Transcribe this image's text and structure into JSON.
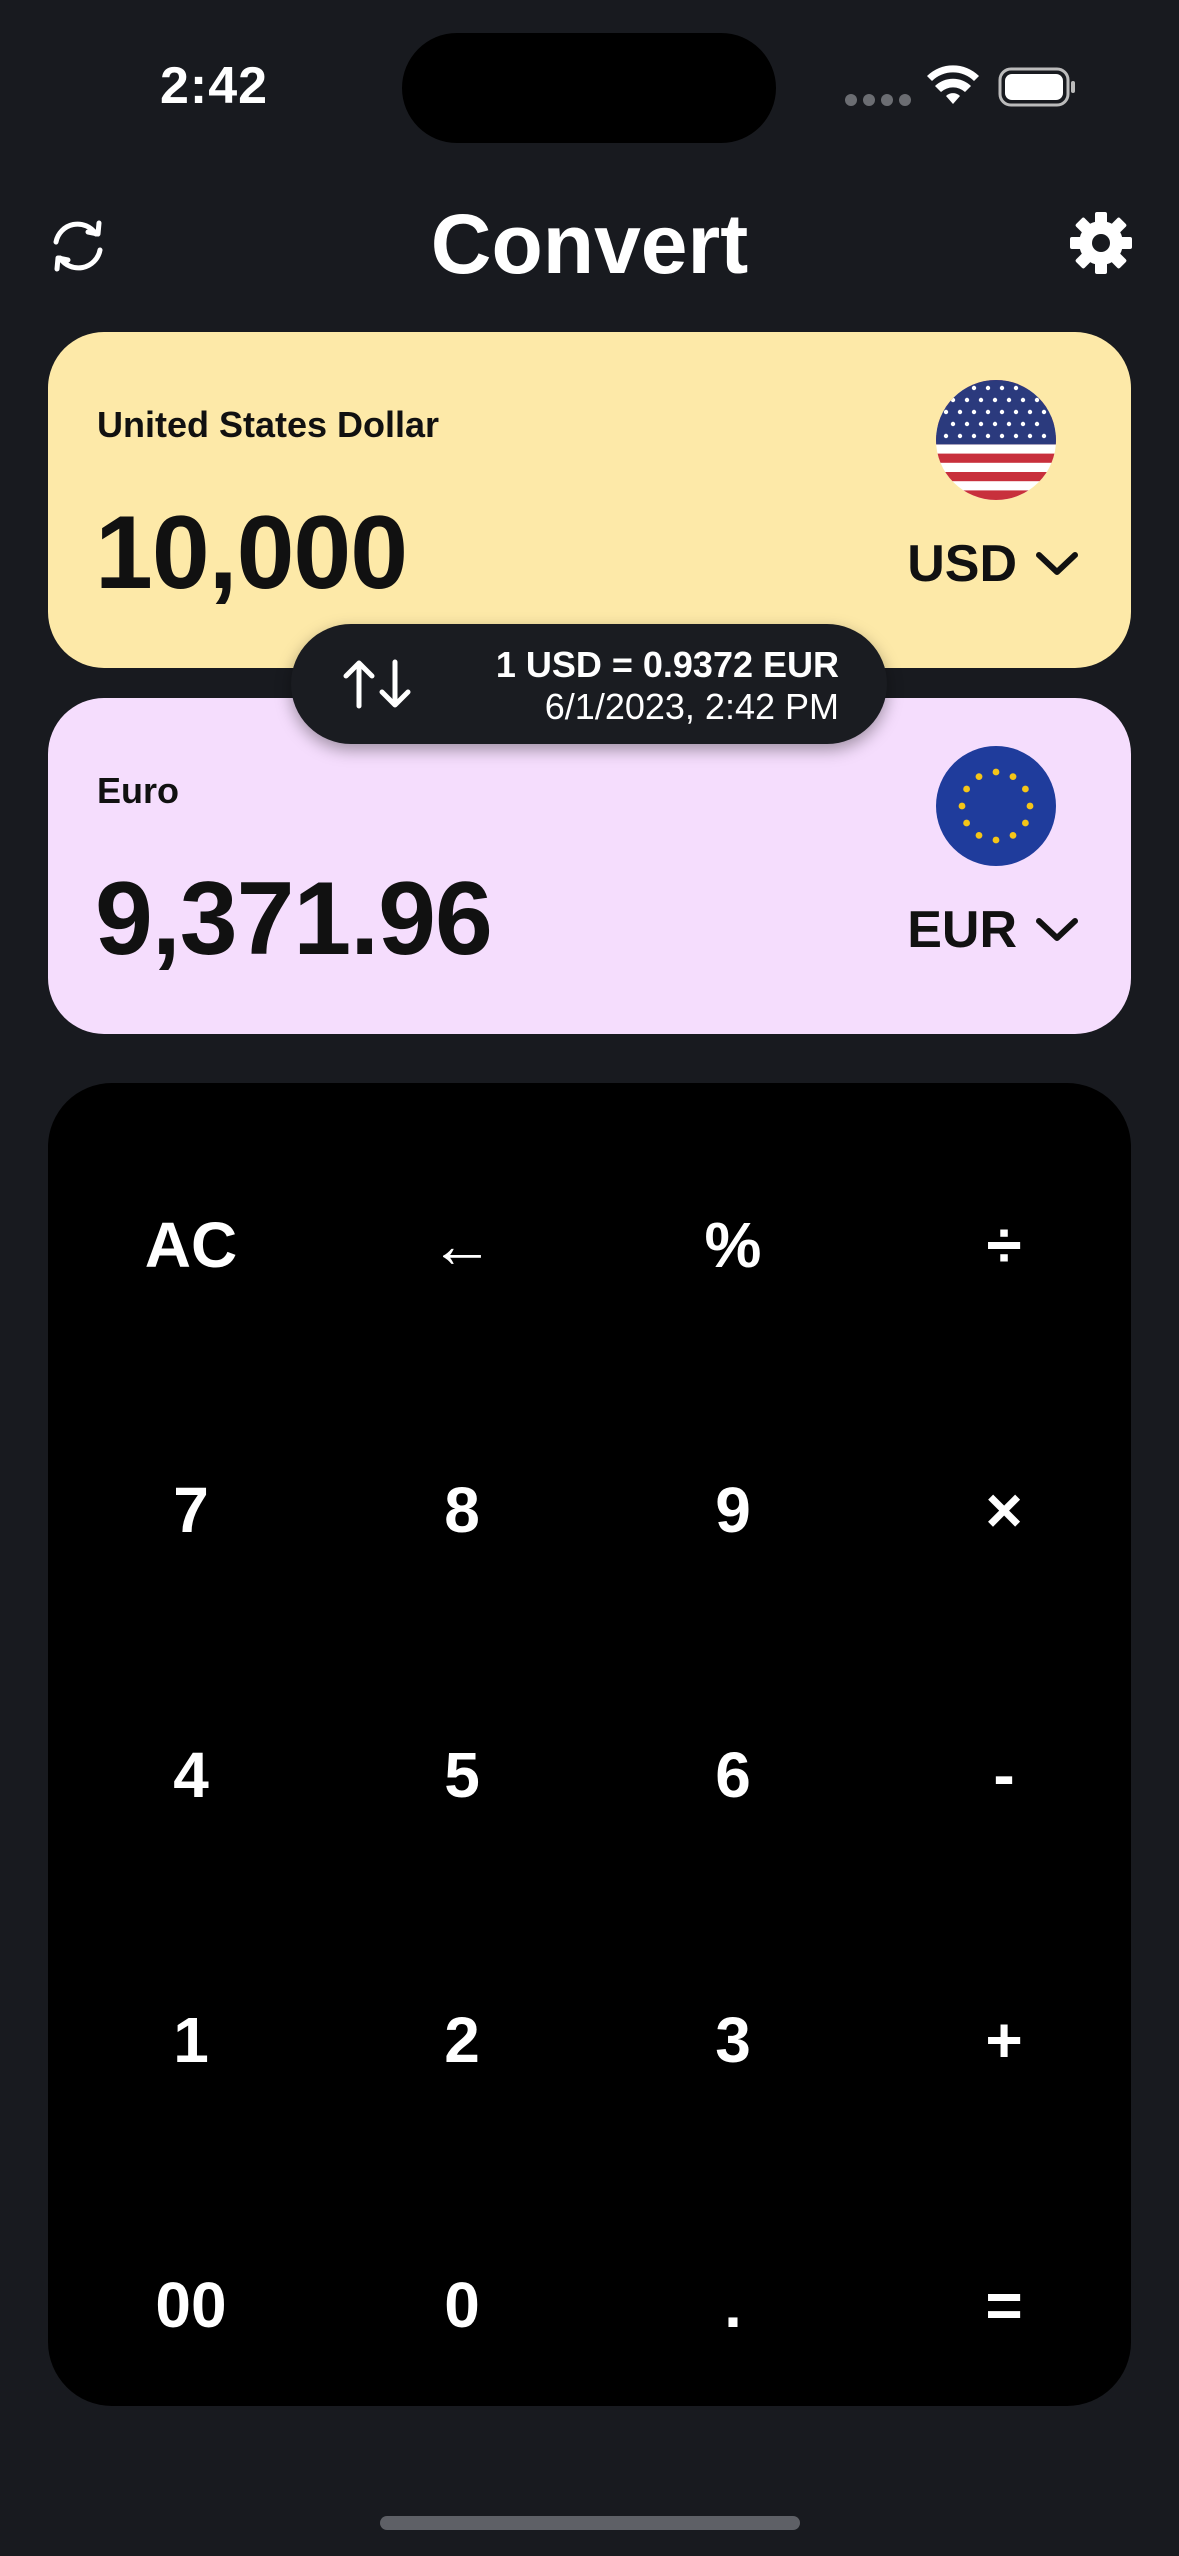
{
  "status_bar": {
    "time": "2:42"
  },
  "header": {
    "title": "Convert",
    "left_icon": "refresh-icon",
    "right_icon": "gear-icon"
  },
  "from_currency": {
    "name": "United States Dollar",
    "amount": "10,000",
    "code": "USD",
    "flag": "us-flag-icon",
    "color": "#fde9a8"
  },
  "to_currency": {
    "name": "Euro",
    "amount": "9,371.96",
    "code": "EUR",
    "flag": "eu-flag-icon",
    "color": "#f5ddfd"
  },
  "rate": {
    "line1": "1 USD = 0.9372 EUR",
    "line2": "6/1/2023, 2:42 PM",
    "icon": "swap-arrows-icon"
  },
  "keypad": {
    "keys": [
      "AC",
      "←",
      "%",
      "÷",
      "7",
      "8",
      "9",
      "×",
      "4",
      "5",
      "6",
      "-",
      "1",
      "2",
      "3",
      "+",
      "00",
      "0",
      ".",
      "="
    ],
    "names": [
      "key-clear",
      "key-backspace",
      "key-percent",
      "key-divide",
      "key-7",
      "key-8",
      "key-9",
      "key-multiply",
      "key-4",
      "key-5",
      "key-6",
      "key-subtract",
      "key-1",
      "key-2",
      "key-3",
      "key-add",
      "key-00",
      "key-0",
      "key-decimal",
      "key-equals"
    ]
  }
}
